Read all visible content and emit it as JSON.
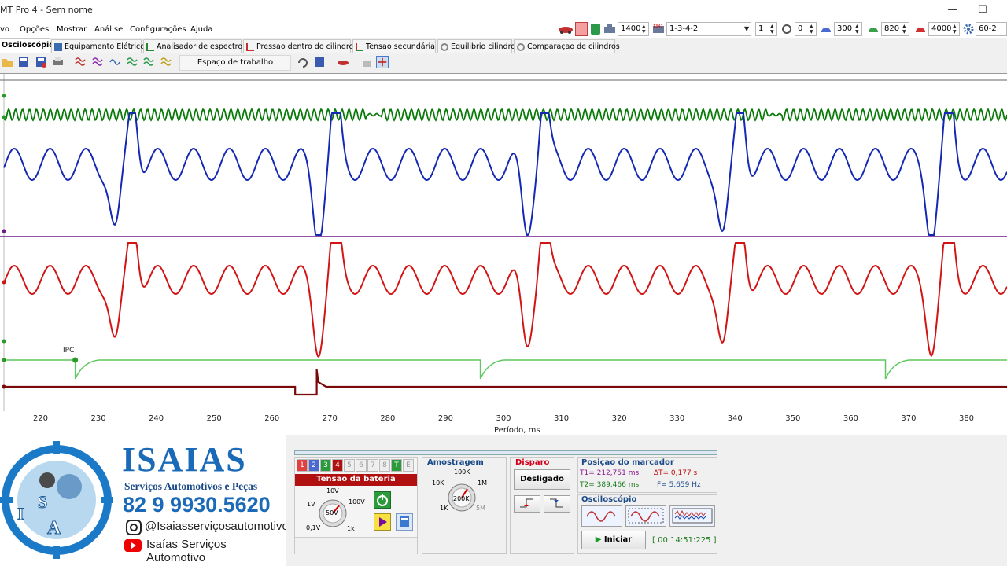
{
  "window": {
    "title": "MT Pro 4 - Sem nome",
    "minimize": "—",
    "maximize": "☐"
  },
  "menu": [
    "vo",
    "Opções",
    "Mostrar",
    "Análise",
    "Configurações",
    "Ajuda"
  ],
  "top_controls": {
    "rpm": "1400",
    "firing_order": "1-3-4-2",
    "cylinder": "1",
    "offset": "0",
    "val_300": "300",
    "val_820": "820",
    "val_4000": "4000",
    "teeth": "60-2"
  },
  "tabs": [
    "Osciloscópio",
    "Equipamento Elétrico",
    "Analisador de espectro",
    "Pressao dentro do cilindro",
    "Tensao secundária",
    "Equilibrio cilindro",
    "Comparaçao de cilindros"
  ],
  "toolbar": {
    "workspace_label": "Espaço de trabalho"
  },
  "scope": {
    "ipc_label": "IPC",
    "x_ticks": [
      "220",
      "230",
      "240",
      "250",
      "260",
      "270",
      "280",
      "290",
      "300",
      "310",
      "320",
      "330",
      "340",
      "350",
      "360",
      "370",
      "380"
    ],
    "x_label": "Período, ms",
    "colors": {
      "green": "#0a7a0a",
      "blue": "#1428b4",
      "red": "#d21414",
      "lightgreen": "#5ec85e",
      "darkred": "#7a0a0a",
      "purple": "#6a1a8a"
    }
  },
  "chart_data": {
    "type": "line",
    "x_label": "Período, ms",
    "x_range": [
      213,
      387
    ],
    "x_ticks": [
      220,
      230,
      240,
      250,
      260,
      270,
      280,
      290,
      300,
      310,
      320,
      330,
      340,
      350,
      360,
      370,
      380
    ],
    "series": [
      {
        "name": "",
        "color": "#0a7a0a",
        "description_points_ms": []
      },
      {
        "name": "",
        "color": "#1428b4",
        "minima_ms": [
          233,
          268,
          304,
          338,
          374
        ],
        "maxima_ms": [
          236,
          271,
          306,
          341,
          376
        ]
      },
      {
        "name": "",
        "color": "#d21414",
        "minima_ms": [
          233,
          268,
          304,
          338,
          374
        ],
        "maxima_ms": [
          236,
          271,
          306,
          341,
          376
        ]
      },
      {
        "name": "",
        "color": "#5ec85e",
        "dips_ms": [
          226,
          296,
          366
        ]
      },
      {
        "name": "",
        "color": "#7a0a0a",
        "pulse_ms": [
          264,
          268
        ]
      }
    ]
  },
  "banner": {
    "name": "ISAIAS",
    "subtitle": "Serviços Automotivos e Peças",
    "phone": "82 9 9930.5620",
    "instagram": "@Isaiasserviçosautomotivo",
    "youtube": "Isaías Serviços Automotivo",
    "logo_letters": "ISA"
  },
  "panel": {
    "channels": [
      "1",
      "2",
      "3",
      "4",
      "5",
      "6",
      "7",
      "8",
      "T",
      "E"
    ],
    "channel_title": "Tensao da bateria",
    "knob_labels": {
      "v10": "10V",
      "v1": "1V",
      "v100": "100V",
      "v01": "0,1V",
      "k1": "1k",
      "center": "50V"
    },
    "sampling_title": "Amostragem",
    "sampling_labels": {
      "k100": "100K",
      "k10": "10K",
      "m1": "1M",
      "k1": "1K",
      "m5": "5M",
      "center": "200K"
    },
    "trigger_title": "Disparo",
    "trigger_button": "Desligado",
    "marker_title": "Posiçao do marcador",
    "t1": "T1= 212,751 ms",
    "t2": "T2= 389,466 ms",
    "dt": "∆T= 0,177 s",
    "freq": "F= 5,659 Hz",
    "osc_title": "Osciloscópio",
    "start_button": "Iniciar",
    "timer": "[ 00:14:51:225 ]"
  }
}
